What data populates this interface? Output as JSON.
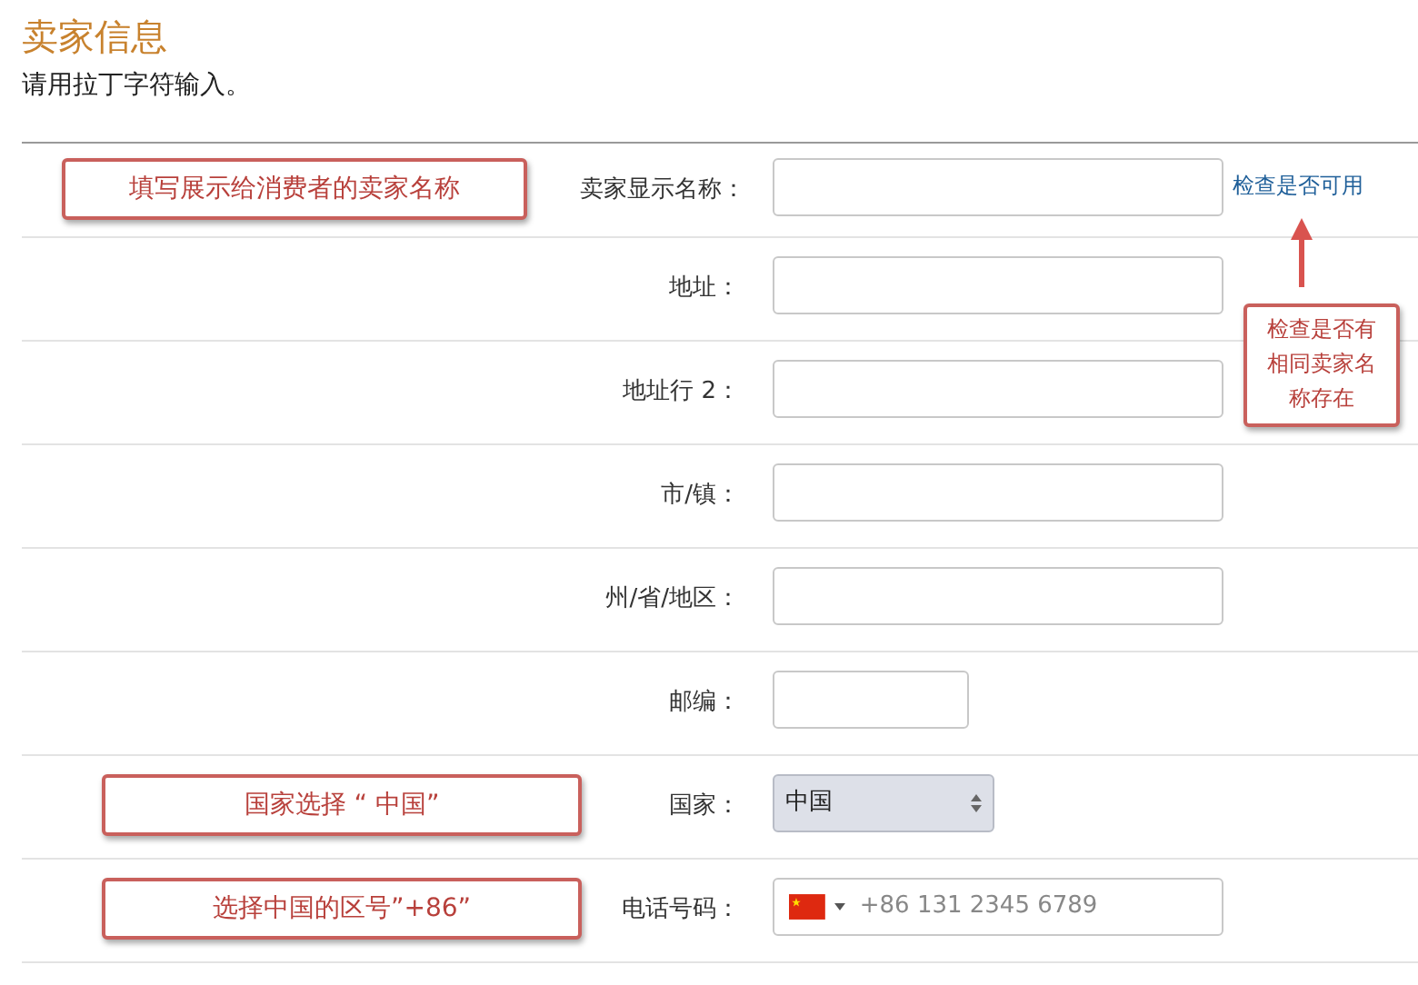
{
  "title": "卖家信息",
  "subtitle": "请用拉丁字符输入。",
  "rows": [
    {
      "label": "卖家显示名称：",
      "kind": "text",
      "link": "检查是否可用",
      "note": "填写展示给消费者的卖家名称"
    },
    {
      "label": "地址：",
      "kind": "text"
    },
    {
      "label": "地址行 2：",
      "kind": "text"
    },
    {
      "label": "市/镇：",
      "kind": "text"
    },
    {
      "label": "州/省/地区：",
      "kind": "text"
    },
    {
      "label": "邮编：",
      "kind": "short"
    },
    {
      "label": "国家：",
      "kind": "select",
      "value": "中国",
      "note": "国家选择 “ 中国”"
    },
    {
      "label": "电话号码：",
      "kind": "phone",
      "placeholder": "+86 131 2345 6789",
      "note": "选择中国的区号”+86”"
    }
  ],
  "callout": "检查是否有相同卖家名称存在"
}
